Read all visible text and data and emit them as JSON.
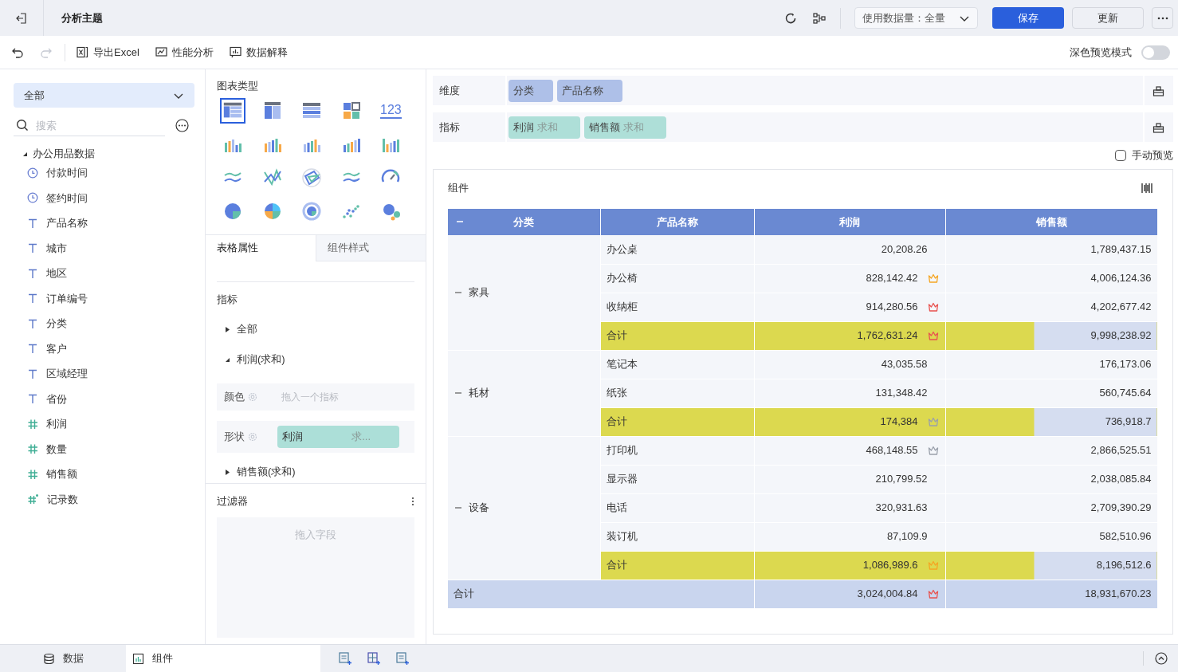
{
  "header": {
    "title": "分析主题",
    "data_amount": "使用数据量：全量",
    "save": "保存",
    "update": "更新"
  },
  "toolbar": {
    "items": [
      "导出Excel",
      "性能分析",
      "数据解释"
    ],
    "dark_preview_label": "深色预览模式",
    "dark_preview_on": false
  },
  "data_panel": {
    "dropdown": "全部",
    "search_placeholder": "搜索",
    "dataset": {
      "name": "办公用品数据",
      "expanded": true,
      "children": [
        {
          "name": "付款时间",
          "kind": "date"
        },
        {
          "name": "签约时间",
          "kind": "date"
        },
        {
          "name": "产品名称",
          "kind": "text"
        },
        {
          "name": "城市",
          "kind": "text"
        },
        {
          "name": "地区",
          "kind": "text"
        },
        {
          "name": "订单编号",
          "kind": "text"
        },
        {
          "name": "分类",
          "kind": "text"
        },
        {
          "name": "客户",
          "kind": "text"
        },
        {
          "name": "区域经理",
          "kind": "text"
        },
        {
          "name": "省份",
          "kind": "text"
        },
        {
          "name": "利润",
          "kind": "number"
        },
        {
          "name": "数量",
          "kind": "number"
        },
        {
          "name": "销售额",
          "kind": "number"
        },
        {
          "name": "记录数",
          "kind": "count"
        }
      ]
    }
  },
  "chart_panel": {
    "title": "图表类型",
    "types": [
      {
        "selected": true
      },
      {
        "selected": false
      },
      {
        "selected": false
      },
      {
        "selected": false
      },
      {
        "selected": false,
        "label": "123"
      },
      {
        "selected": false
      },
      {
        "selected": false
      },
      {
        "selected": false
      },
      {
        "selected": false
      },
      {
        "selected": false
      },
      {
        "selected": false
      },
      {
        "selected": false
      },
      {
        "selected": false
      },
      {
        "selected": false
      },
      {
        "selected": false
      },
      {
        "selected": false
      },
      {
        "selected": false
      },
      {
        "selected": false
      },
      {
        "selected": false
      },
      {
        "selected": false
      }
    ]
  },
  "property_tabs": [
    {
      "label": "表格属性",
      "selected": true
    },
    {
      "label": "组件样式",
      "selected": false
    }
  ],
  "metrics": {
    "title": "指标",
    "items": [
      {
        "label": "全部",
        "expanded": false
      },
      {
        "label": "利润(求和)",
        "expanded": true
      }
    ],
    "color_label": "颜色",
    "color_placeholder": "拖入一个指标",
    "shape_label": "形状",
    "shape_field": "利润",
    "shape_agg": "求...",
    "next": "销售额(求和)"
  },
  "filter": {
    "title": "过滤器",
    "placeholder": "拖入字段"
  },
  "dimensions": {
    "label": "维度",
    "fields": [
      "分类",
      "产品名称"
    ]
  },
  "measures": {
    "label": "指标",
    "fields": [
      {
        "name": "利润",
        "agg": "求和"
      },
      {
        "name": "销售额",
        "agg": "求和"
      }
    ]
  },
  "manual_preview": {
    "label": "手动预览",
    "checked": false
  },
  "component": {
    "title": "组件",
    "table": {
      "columns": [
        "分类",
        "产品名称",
        "利润",
        "销售额"
      ],
      "groups": [
        {
          "category": "家具",
          "rows": [
            {
              "product": "办公桌",
              "profit": "20,208.26",
              "sales": "1,789,437.15"
            },
            {
              "product": "办公椅",
              "profit": "828,142.42",
              "sales": "4,006,124.36",
              "color": "#f5a623"
            },
            {
              "product": "收纳柜",
              "profit": "914,280.56",
              "sales": "4,202,677.42",
              "color": "#e8524f"
            }
          ],
          "subtotal": {
            "label": "合计",
            "profit": "1,762,631.24",
            "sales": "9,998,238.92",
            "color": "#e8524f"
          }
        },
        {
          "category": "耗材",
          "rows": [
            {
              "product": "笔记本",
              "profit": "43,035.58",
              "sales": "176,173.06"
            },
            {
              "product": "纸张",
              "profit": "131,348.42",
              "sales": "560,745.64"
            }
          ],
          "subtotal": {
            "label": "合计",
            "profit": "174,384",
            "sales": "736,918.7",
            "color": "#9aa0ab"
          }
        },
        {
          "category": "设备",
          "rows": [
            {
              "product": "打印机",
              "profit": "468,148.55",
              "sales": "2,866,525.51",
              "color": "#9aa0ab"
            },
            {
              "product": "显示器",
              "profit": "210,799.52",
              "sales": "2,038,085.84"
            },
            {
              "product": "电话",
              "profit": "320,931.63",
              "sales": "2,709,390.29"
            },
            {
              "product": "装订机",
              "profit": "87,109.9",
              "sales": "582,510.96"
            }
          ],
          "subtotal": {
            "label": "合计",
            "profit": "1,086,989.6",
            "sales": "8,196,512.6",
            "color": "#f5a623"
          }
        }
      ],
      "total": {
        "label": "合计",
        "profit": "3,024,004.84",
        "sales": "18,931,670.23",
        "color": "#e8524f"
      }
    }
  },
  "bottom_tabs": [
    {
      "label": "数据",
      "selected": false
    },
    {
      "label": "组件",
      "selected": true
    }
  ]
}
